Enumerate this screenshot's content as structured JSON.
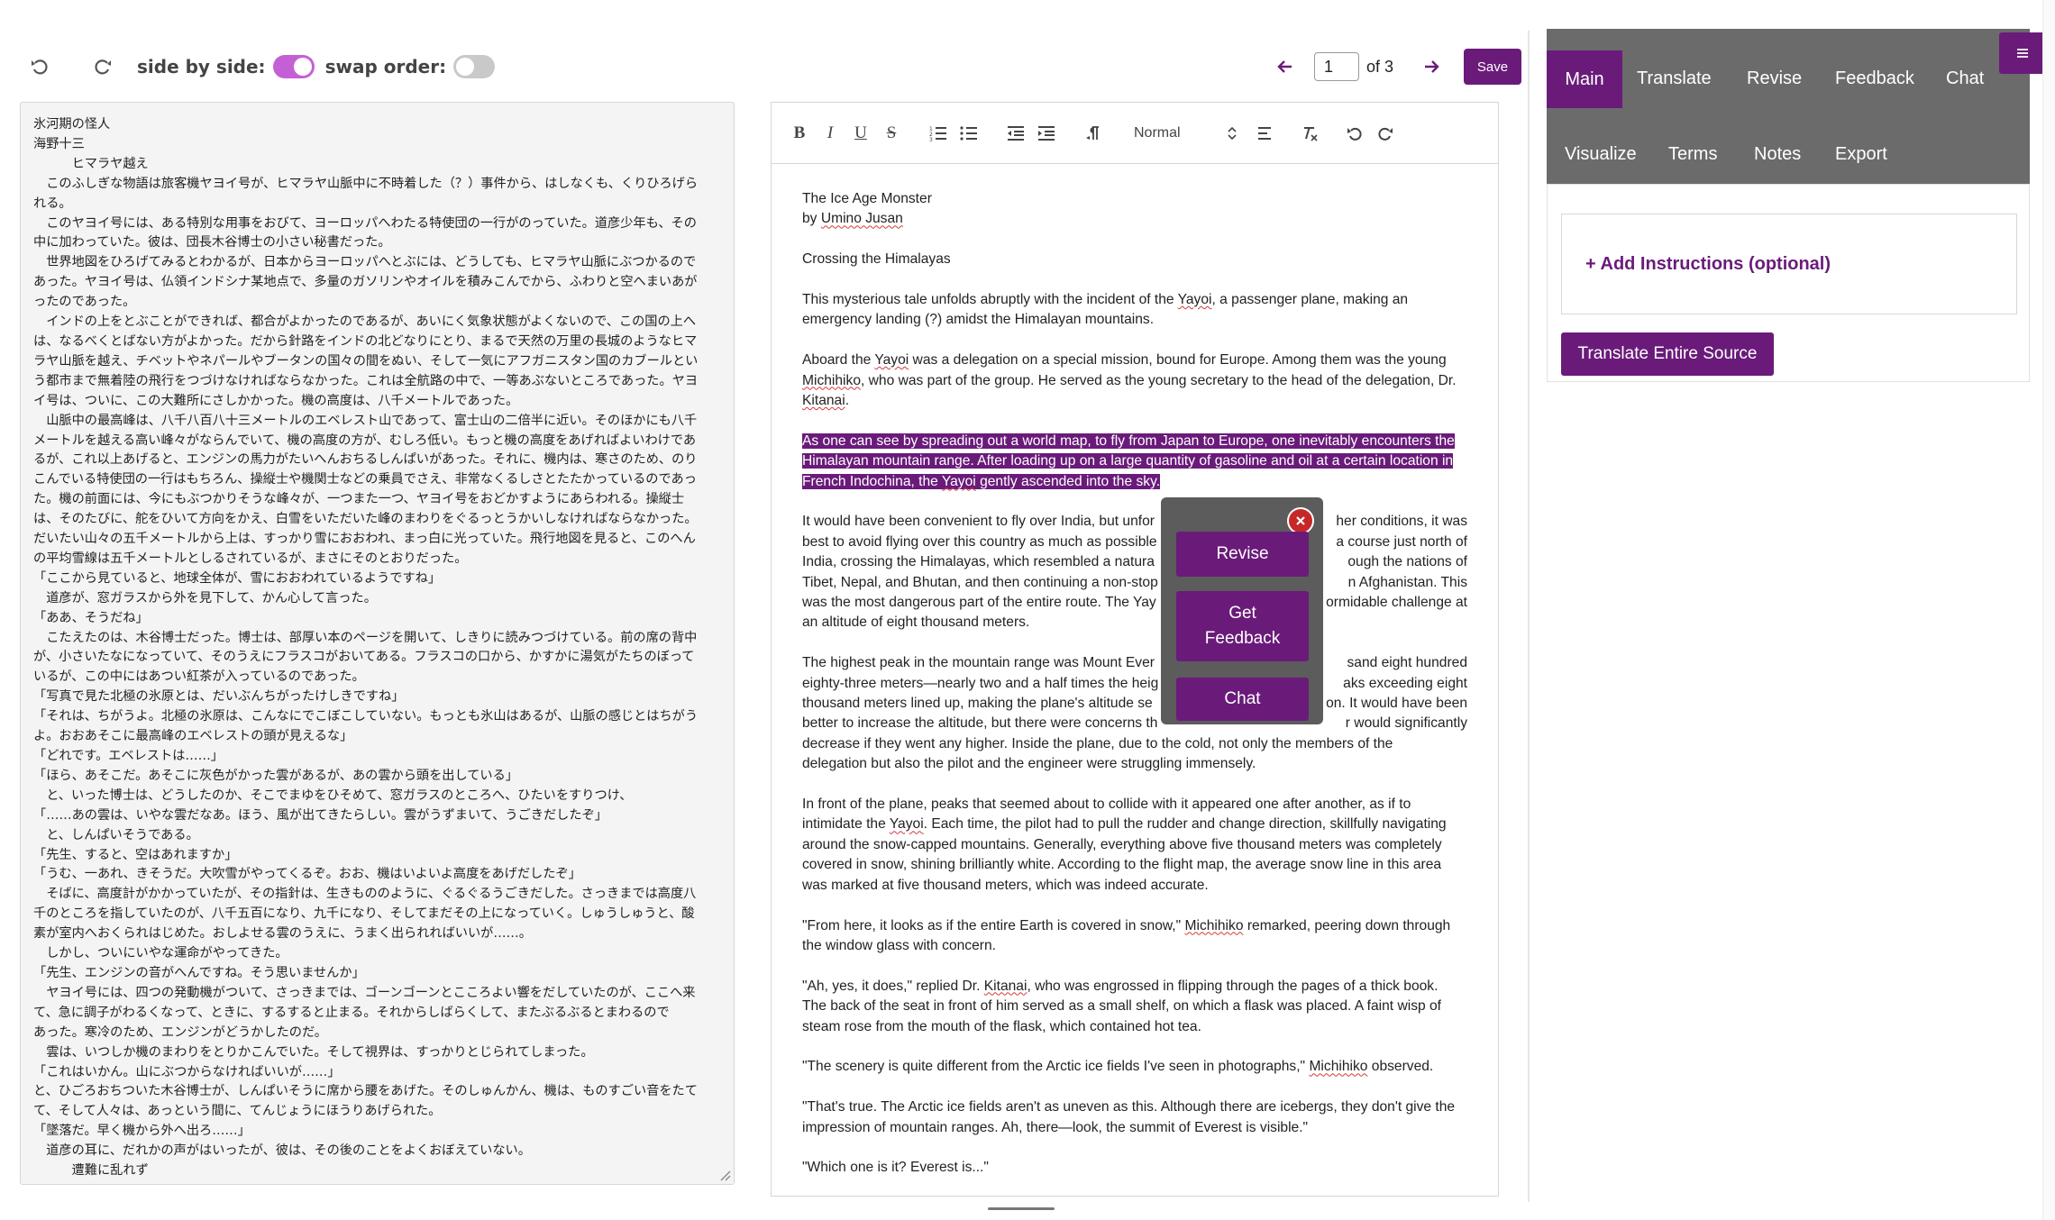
{
  "top": {
    "undo_icon": "undo-icon",
    "redo_icon": "redo-icon",
    "side_by_side_label": "side by side:",
    "side_by_side_on": true,
    "swap_order_label": "swap order:",
    "swap_order_on": false
  },
  "pager": {
    "current_page": "1",
    "of_label": "of 3",
    "save_label": "Save"
  },
  "source": {
    "lines": [
      "氷河期の怪人",
      "海野十三",
      "　　　ヒマラヤ越え",
      "　このふしぎな物語は旅客機ヤヨイ号が、ヒマラヤ山脈中に不時着した（？）事件から、はしなくも、くりひろげら",
      "れる。",
      "　このヤヨイ号には、ある特別な用事をおびて、ヨーロッパへわたる特使団の一行がのっていた。道彦少年も、その",
      "中に加わっていた。彼は、団長木谷博士の小さい秘書だった。",
      "　世界地図をひろげてみるとわかるが、日本からヨーロッパへとぶには、どうしても、ヒマラヤ山脈にぶつかるので",
      "あった。ヤヨイ号は、仏領インドシナ某地点で、多量のガソリンやオイルを積みこんでから、ふわりと空へまいあが",
      "ったのであった。",
      "　インドの上をとぶことができれば、都合がよかったのであるが、あいにく気象状態がよくないので、この国の上へ",
      "は、なるべくとばない方がよかった。だから針路をインドの北どなりにとり、まるで天然の万里の長城のようなヒマ",
      "ラヤ山脈を越え、チベットやネパールやブータンの国々の間をぬい、そして一気にアフガニスタン国のカブールとい",
      "う都市まで無着陸の飛行をつづけなければならなかった。これは全航路の中で、一等あぶないところであった。ヤヨ",
      "イ号は、ついに、この大難所にさしかかった。機の高度は、八千メートルであった。",
      "　山脈中の最高峰は、八千八百八十三メートルのエベレスト山であって、富士山の二倍半に近い。そのほかにも八千",
      "メートルを越える高い峰々がならんでいて、機の高度の方が、むしろ低い。もっと機の高度をあげればよいわけであ",
      "るが、これ以上あげると、エンジンの馬力がたいへんおちるしんぱいがあった。それに、機内は、寒さのため、のり",
      "こんでいる特使団の一行はもちろん、操縦士や機関士などの乗員でさえ、非常なくるしさとたたかっているのであっ",
      "た。機の前面には、今にもぶつかりそうな峰々が、一つまた一つ、ヤヨイ号をおどかすようにあらわれる。操縦士",
      "は、そのたびに、舵をひいて方向をかえ、白雪をいただいた峰のまわりをぐるっとうかいしなければならなかった。",
      "だいたい山々の五千メートルから上は、すっかり雪におおわれ、まっ白に光っていた。飛行地図を見ると、このへん",
      "の平均雪線は五千メートルとしるされているが、まさにそのとおりだった。",
      "「ここから見ていると、地球全体が、雪におおわれているようですね」",
      "　道彦が、窓ガラスから外を見下して、かん心して言った。",
      "「ああ、そうだね」",
      "　こたえたのは、木谷博士だった。博士は、部厚い本のページを開いて、しきりに読みつづけている。前の席の背中",
      "が、小さいたなになっていて、そのうえにフラスコがおいてある。フラスコの口から、かすかに湯気がたちのぼって",
      "いるが、この中にはあつい紅茶が入っているのであった。",
      "「写真で見た北極の氷原とは、だいぶんちがったけしきですね」",
      "「それは、ちがうよ。北極の氷原は、こんなにでこぼこしていない。もっとも氷山はあるが、山脈の感じとはちがう",
      "よ。おおあそこに最高峰のエベレストの頭が見えるな」",
      "「どれです。エベレストは……」",
      "「ほら、あそこだ。あそこに灰色がかった雲があるが、あの雲から頭を出している」",
      "　と、いった博士は、どうしたのか、そこでまゆをひそめて、窓ガラスのところへ、ひたいをすりつけ、",
      "「……あの雲は、いやな雲だなあ。ほう、風が出てきたらしい。雲がうずまいて、うごきだしたぞ」",
      "　と、しんぱいそうである。",
      "「先生、すると、空はあれますか」",
      "「うむ、一あれ、きそうだ。大吹雪がやってくるぞ。おお、機はいよいよ高度をあげだしたぞ」",
      "　そばに、高度計がかかっていたが、その指針は、生きもののように、ぐるぐるうごきだした。さっきまでは高度八",
      "千のところを指していたのが、八千五百になり、九千になり、そしてまだその上になっていく。しゅうしゅうと、酸",
      "素が室内へおくられはじめた。おしよせる雲のうえに、うまく出られればいいが……。",
      "　しかし、ついにいやな運命がやってきた。",
      "「先生、エンジンの音がへんですね。そう思いませんか」",
      "　ヤヨイ号には、四つの発動機がついて、さっきまでは、ゴーンゴーンとこころよい響をだしていたのが、ここへ来",
      "て、急に調子がわるくなって、ときに、するすると止まる。それからしばらくして、またぶるぶるとまわるので",
      "あった。寒冷のため、エンジンがどうかしたのだ。",
      "　雲は、いつしか機のまわりをとりかこんでいた。そして視界は、すっかりとじられてしまった。",
      "「これはいかん。山にぶつからなければいいが……」",
      "と、ひごろおちついた木谷博士が、しんぱいそうに席から腰をあげた。そのしゅんかん、機は、ものすごい音をたて",
      "て、そして人々は、あっという間に、てんじょうにほうりあげられた。",
      "「墜落だ。早く機から外へ出ろ……」",
      "　道彦の耳に、だれかの声がはいったが、彼は、その後のことをよくおぼえていない。",
      "　　　遭難に乱れず"
    ]
  },
  "editor": {
    "toolbar": {
      "bold": "B",
      "italic": "I",
      "underline": "U",
      "strike": "S",
      "format_select": "Normal"
    },
    "title_line": "The Ice Age Monster",
    "byline_prefix": "by ",
    "author": "Umino Jusan",
    "heading": "Crossing the Himalayas",
    "p1": {
      "a": "This mysterious tale unfolds abruptly with the incident of the ",
      "yayoi": "Yayoi",
      "b": ", a passenger plane, making an",
      "c": "emergency landing (?) amidst the Himalayan mountains."
    },
    "p2": {
      "a": "Aboard the ",
      "yayoi": "Yayoi",
      "b": " was a delegation on a special mission, bound for Europe. Among them was the young",
      "michihiko": "Michihiko",
      "c": ", who was part of the group. He served as the young secretary to the head of the delegation, Dr.",
      "kitanai": "Kitanai",
      "d": "."
    },
    "p3": {
      "a": "As one can see by spreading out a world map, to fly from Japan to Europe, one inevitably encounters the",
      "b": "Himalayan mountain range. After loading up on a large quantity of gasoline and oil at a certain location in",
      "c": "French Indochina, the ",
      "yayoi": "Yayoi",
      "d": " gently ascended into the sky."
    },
    "p4": [
      "It would have been convenient to fly over India, but unfor",
      "best to avoid flying over this country as much as possible",
      "India, crossing the Himalayas, which resembled a natura",
      "Tibet, Nepal, and Bhutan, and then continuing a non-stop",
      "was the most dangerous part of the entire route. The Yay",
      "an altitude of eight thousand meters."
    ],
    "p4_right": [
      "her conditions, it was",
      "a course just north of",
      "ough the nations of",
      "n Afghanistan. This",
      "ormidable challenge at",
      ""
    ],
    "p5": [
      "The highest peak in the mountain range was Mount Ever",
      "eighty-three meters—nearly two and a half times the heig",
      "thousand meters lined up, making the plane's altitude se",
      "better to increase the altitude, but there were concerns th",
      "decrease if they went any higher. Inside the plane, due to the cold, not only the members of the",
      "delegation but also the pilot and the engineer were struggling immensely."
    ],
    "p5_right": [
      "sand eight hundred",
      "aks exceeding eight",
      "on. It would have been",
      "r would significantly",
      "",
      ""
    ],
    "p6": {
      "a": "In front of the plane, peaks that seemed about to collide with it appeared one after another, as if to",
      "b": "intimidate the ",
      "yayoi": "Yayoi",
      "c": ". Each time, the pilot had to pull the rudder and change direction, skillfully navigating",
      "d": "around the snow-capped mountains. Generally, everything above five thousand meters was completely",
      "e": "covered in snow, shining brilliantly white. According to the flight map, the average snow line in this area",
      "f": "was marked at five thousand meters, which was indeed accurate."
    },
    "p7": {
      "a": "\"From here, it looks as if the entire Earth is covered in snow,\" ",
      "michihiko": "Michihiko",
      "b": " remarked, peering down through",
      "c": "the window glass with concern."
    },
    "p8": {
      "a": "\"Ah, yes, it does,\" replied Dr. ",
      "kitanai": "Kitanai",
      "b": ", who was engrossed in flipping through the pages of a thick book.",
      "c": "The back of the seat in front of him served as a small shelf, on which a flask was placed. A faint wisp of",
      "d": "steam rose from the mouth of the flask, which contained hot tea."
    },
    "p9": {
      "a": "\"The scenery is quite different from the Arctic ice fields I've seen in photographs,\" ",
      "michihiko": "Michihiko",
      "b": " observed."
    },
    "p10": {
      "a": "\"That's true. The Arctic ice fields aren't as uneven as this. Although there are icebergs, they don't give the",
      "b": "impression of mountain ranges. Ah, there—look, the summit of Everest is visible.\""
    },
    "p11": "\"Which one is it? Everest is...\""
  },
  "popup": {
    "revise": "Revise",
    "feedback_1": "Get",
    "feedback_2": "Feedback",
    "chat": "Chat",
    "close_icon": "close-icon"
  },
  "right_panel": {
    "tabs_row1": [
      "Main",
      "Translate",
      "Revise",
      "Feedback",
      "Chat"
    ],
    "tabs_row2": [
      "Visualize",
      "Terms",
      "Notes",
      "Export"
    ],
    "active_tab": "Main",
    "menu_icon": "hamburger-icon",
    "add_instructions": "+ Add Instructions (optional)",
    "translate_button": "Translate Entire Source"
  },
  "colors": {
    "accent": "#6a1b7a",
    "toggle_on": "#c55fd6",
    "header_gray": "#6b6b6b",
    "spell_error": "#d23a3a"
  }
}
